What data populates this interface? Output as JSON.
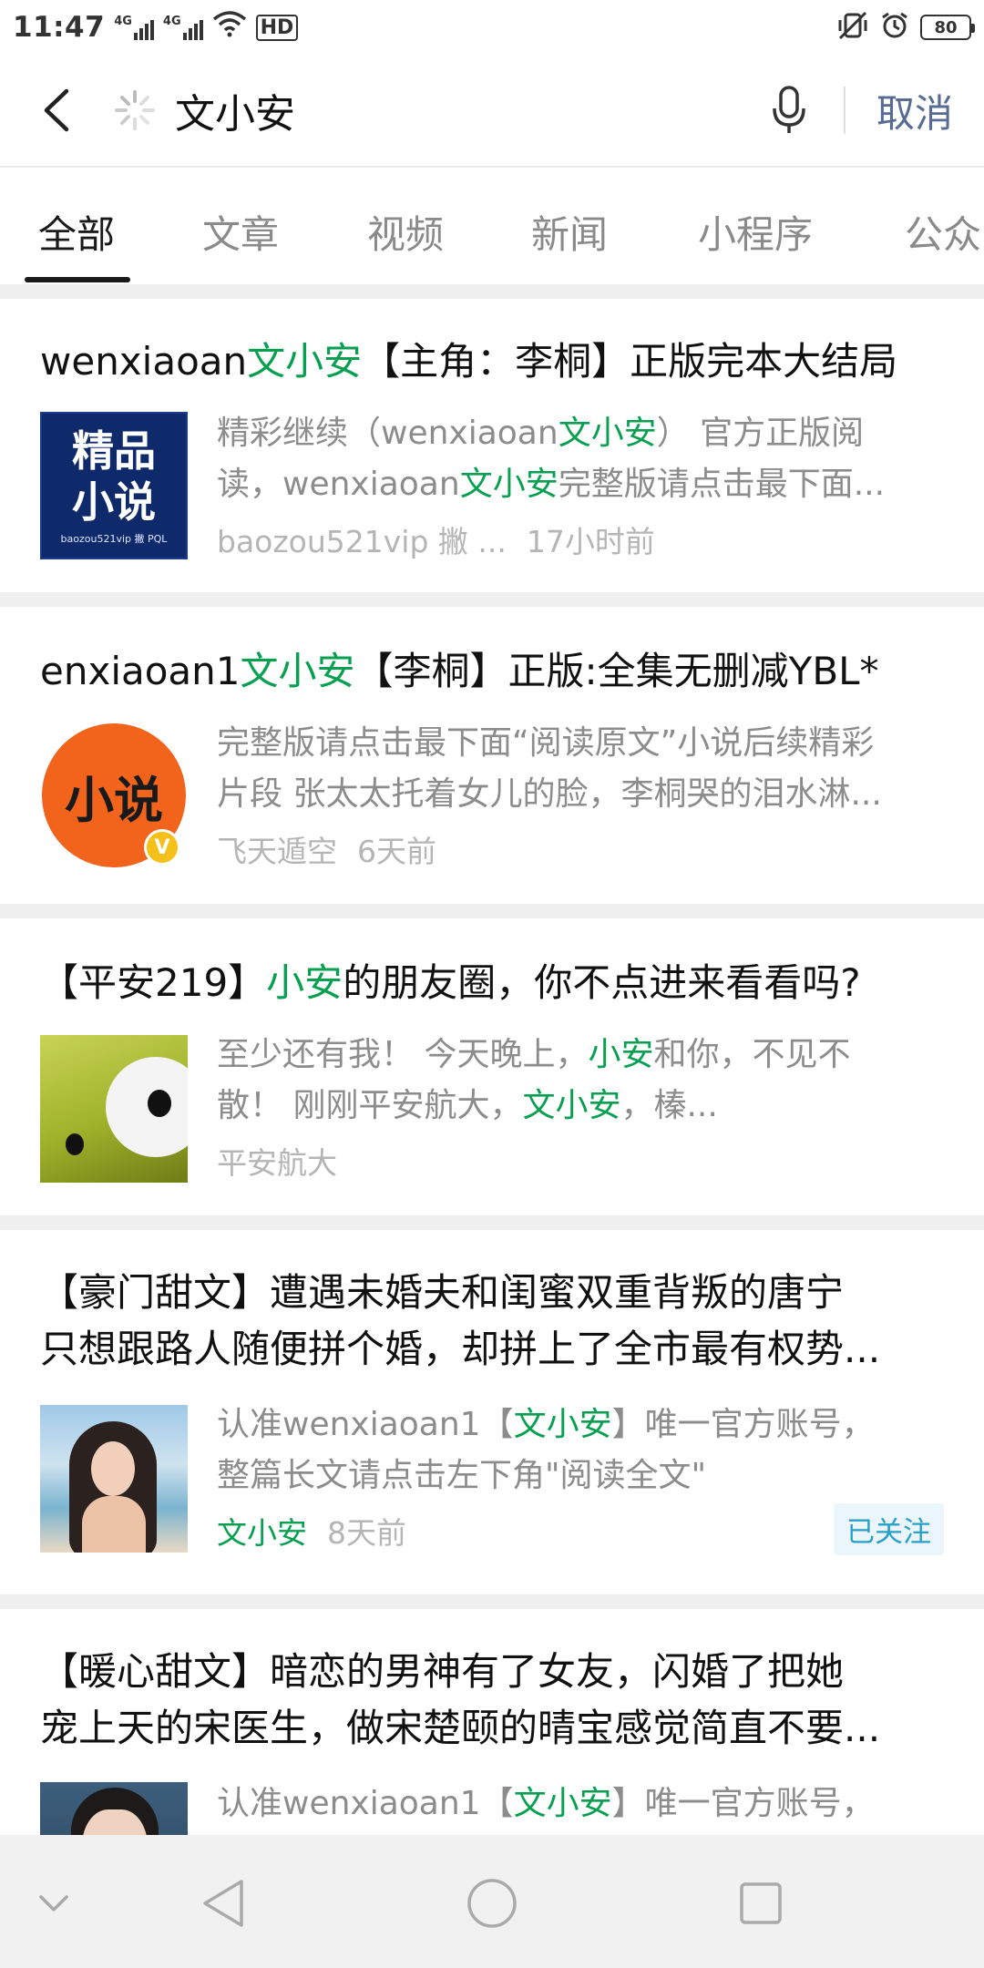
{
  "status_bar": {
    "time": "11:47",
    "network_1": "4G",
    "network_2": "4G",
    "hd": "HD",
    "battery": "80",
    "icons": [
      "signal-icon",
      "signal-icon",
      "wifi-icon",
      "hd-icon",
      "vibrate-icon",
      "alarm-icon",
      "battery-icon"
    ]
  },
  "search": {
    "query": "文小安",
    "cancel_label": "取消",
    "icons": [
      "back-arrow-icon",
      "loading-spinner-icon",
      "microphone-icon"
    ]
  },
  "tabs": [
    {
      "label": "全部",
      "active": true
    },
    {
      "label": "文章",
      "active": false
    },
    {
      "label": "视频",
      "active": false
    },
    {
      "label": "新闻",
      "active": false
    },
    {
      "label": "小程序",
      "active": false
    },
    {
      "label": "公众",
      "active": false
    }
  ],
  "results": [
    {
      "title_pre": "wenxiaoan",
      "title_hl": "文小安",
      "title_post": "【主角：李桐】正版完本大结局",
      "summary_1": {
        "pre": "精彩继续（wenxiaoan",
        "hl": "文小安",
        "post": "） 官方正版阅"
      },
      "summary_2": {
        "pre": "读，wenxiaoan",
        "hl": "文小安",
        "post": "完整版请点击最下面..."
      },
      "source": "baozou521vip 撇 ...",
      "time": "17小时前",
      "thumb_text_1": "精品",
      "thumb_text_2": "小说",
      "thumb_caption": "baozou521vip 撇 PQL"
    },
    {
      "title_pre": "enxiaoan1",
      "title_hl": "文小安",
      "title_post": "【李桐】正版:全集无删减YBL*",
      "summary_1": "完整版请点击最下面“阅读原文”小说后续精彩",
      "summary_2": "片段 张太太托着女儿的脸，李桐哭的泪水淋...",
      "source": "飞天遁空",
      "time": "6天前",
      "thumb_text": "小说",
      "thumb_badge": "V"
    },
    {
      "title_pre": "【平安219】",
      "title_hl": "小安",
      "title_post": "的朋友圈，你不点进来看看吗?",
      "summary_1": {
        "pre": "至少还有我！ 今天晚上，",
        "hl": "小安",
        "post": "和你，不见不"
      },
      "summary_2": {
        "pre": "散！ 刚刚平安航大，",
        "hl": "文小安",
        "post": "，榛..."
      },
      "source": "平安航大"
    },
    {
      "title_line_1": "【豪门甜文】遭遇未婚夫和闺蜜双重背叛的唐宁",
      "title_line_2": "只想跟路人随便拼个婚，却拼上了全市最有权势...",
      "summary_1": {
        "pre": "认准wenxiaoan1【",
        "hl": "文小安",
        "post": "】唯一官方账号，"
      },
      "summary_2": "整篇长文请点击左下角\"阅读全文\"",
      "source": "文小安",
      "time": "8天前",
      "follow_label": "已关注"
    },
    {
      "title_line_1": "【暖心甜文】暗恋的男神有了女友，闪婚了把她",
      "title_line_2": "宠上天的宋医生，做宋楚颐的晴宝感觉简直不要...",
      "summary_1": {
        "pre": "认准wenxiaoan1【",
        "hl": "文小安",
        "post": "】唯一官方账号，"
      }
    }
  ],
  "nav_bar": {
    "icons": [
      "hide-nav-chevron-icon",
      "back-triangle-icon",
      "home-circle-icon",
      "recents-square-icon"
    ]
  },
  "colors": {
    "highlight": "#07a050",
    "cancel": "#576b95",
    "meta_gray": "#b5b5b5",
    "follow_bg": "#eaf6fb",
    "follow_text": "#2aa0c9"
  }
}
